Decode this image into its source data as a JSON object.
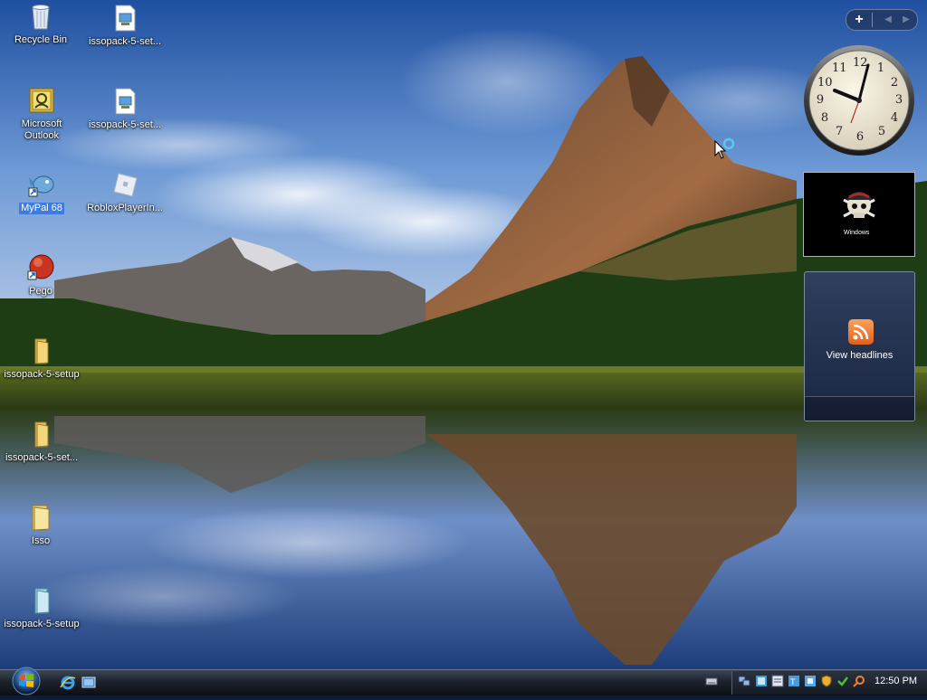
{
  "desktop": {
    "icons": [
      {
        "label": "Recycle Bin"
      },
      {
        "label": "issopack-5-set..."
      },
      {
        "label": "Microsoft Outlook"
      },
      {
        "label": "issopack-5-set..."
      },
      {
        "label": "MyPal 68"
      },
      {
        "label": "RobloxPlayerIn..."
      },
      {
        "label": "Pego"
      },
      {
        "label": "issopack-5-setup"
      },
      {
        "label": "issopack-5-set..."
      },
      {
        "label": "Isso"
      },
      {
        "label": "issopack-5-setup"
      }
    ]
  },
  "gadgets": {
    "controls": {
      "add_label": "+"
    },
    "clock": {
      "numerals": [
        "12",
        "1",
        "2",
        "3",
        "4",
        "5",
        "6",
        "7",
        "8",
        "9",
        "10",
        "11"
      ]
    },
    "slideshow": {
      "caption": "Windows"
    },
    "feed": {
      "title": "View headlines",
      "icon": "rss-icon"
    }
  },
  "taskbar": {
    "clock": "12:50 PM",
    "quick_launch": [
      "internet-explorer-icon",
      "show-desktop-icon"
    ],
    "tray_icons": [
      "keyboard-icon",
      "network-icon",
      "app-icon",
      "app-icon",
      "app-icon",
      "shield-icon",
      "check-icon",
      "search-icon",
      "speaker-icon"
    ]
  },
  "colors": {
    "selection": "#3d7be0",
    "taskbar": "#1c222c",
    "feed_accent": "#e2601a"
  }
}
